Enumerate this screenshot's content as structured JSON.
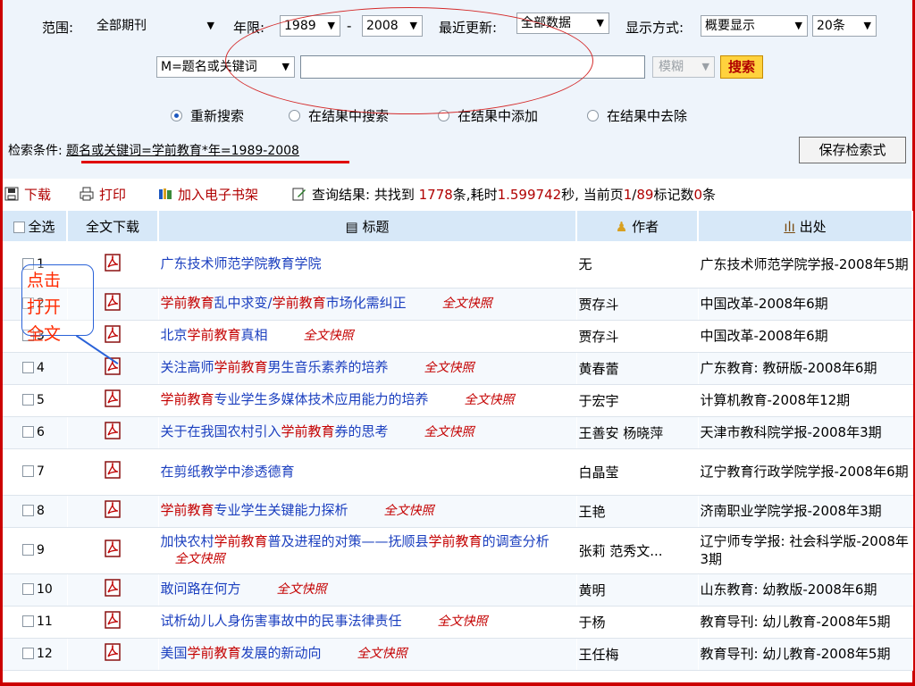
{
  "search": {
    "scope_label": "范围:",
    "scope_value": "全部期刊",
    "year_label": "年限:",
    "year_from": "1989",
    "year_dash": "-",
    "year_to": "2008",
    "update_label": "最近更新:",
    "update_value": "全部数据",
    "display_label": "显示方式:",
    "display_value": "概要显示",
    "count_value": "20条",
    "field_value": "M=题名或关键词",
    "keyword_value": "",
    "match_value": "模糊",
    "search_button": "搜索",
    "radios": [
      {
        "label": "重新搜索",
        "checked": true
      },
      {
        "label": "在结果中搜索",
        "checked": false
      },
      {
        "label": "在结果中添加",
        "checked": false
      },
      {
        "label": "在结果中去除",
        "checked": false
      }
    ],
    "condition_label": "检索条件:",
    "condition_value": "题名或关键词=学前教育*年=1989-2008",
    "save_button": "保存检索式"
  },
  "toolbar": {
    "download": "下载",
    "print": "打印",
    "add_shelf": "加入电子书架",
    "result_prefix": "查询结果: 共找到",
    "total": "1778",
    "items_unit": "条,耗时",
    "elapsed": "1.599742",
    "seconds_unit": "秒,",
    "page_prefix": "当前页",
    "page_current": "1",
    "page_sep": "/",
    "page_total": "89",
    "marked_prefix": "标记数",
    "marked": "0",
    "marked_suffix": "条"
  },
  "table": {
    "headers": {
      "select_all": "全选",
      "fulltext": "全文下载",
      "title": "标题",
      "author": "作者",
      "source": "出处"
    },
    "fulltext_tag": "全文快照",
    "rows": [
      {
        "num": "1",
        "title": [
          {
            "t": "广东技术师范学院教育学院"
          }
        ],
        "snapshot": false,
        "author": "无",
        "source": "广东技术师范学院学报-2008年5期"
      },
      {
        "num": "2",
        "title": [
          {
            "t": "学前教育",
            "h": true
          },
          {
            "t": "乱中求变/"
          },
          {
            "t": "学前教育",
            "h": true
          },
          {
            "t": "市场化需纠正"
          }
        ],
        "snapshot": true,
        "author": "贾存斗",
        "source": "中国改革-2008年6期"
      },
      {
        "num": "3",
        "title": [
          {
            "t": "北京"
          },
          {
            "t": "学前教育",
            "h": true
          },
          {
            "t": "真相"
          }
        ],
        "snapshot": true,
        "author": "贾存斗",
        "source": "中国改革-2008年6期"
      },
      {
        "num": "4",
        "title": [
          {
            "t": "关注高师"
          },
          {
            "t": "学前教育",
            "h": true
          },
          {
            "t": "男生音乐素养的培养"
          }
        ],
        "snapshot": true,
        "author": "黄春蕾",
        "source": "广东教育: 教研版-2008年6期"
      },
      {
        "num": "5",
        "title": [
          {
            "t": "学前教育",
            "h": true
          },
          {
            "t": "专业学生多媒体技术应用能力的培养"
          }
        ],
        "snapshot": true,
        "author": "于宏宇",
        "source": "计算机教育-2008年12期"
      },
      {
        "num": "6",
        "title": [
          {
            "t": "关于在我国农村引入"
          },
          {
            "t": "学前教育",
            "h": true
          },
          {
            "t": "券的思考"
          }
        ],
        "snapshot": true,
        "author": "王善安 杨晓萍",
        "source": "天津市教科院学报-2008年3期"
      },
      {
        "num": "7",
        "title": [
          {
            "t": "在剪纸教学中渗透德育"
          }
        ],
        "snapshot": false,
        "author": "白晶莹",
        "source": "辽宁教育行政学院学报-2008年6期"
      },
      {
        "num": "8",
        "title": [
          {
            "t": "学前教育",
            "h": true
          },
          {
            "t": "专业学生关键能力探析"
          }
        ],
        "snapshot": true,
        "author": "王艳",
        "source": "济南职业学院学报-2008年3期"
      },
      {
        "num": "9",
        "title": [
          {
            "t": "加快农村"
          },
          {
            "t": "学前教育",
            "h": true
          },
          {
            "t": "普及进程的对策——抚顺县"
          },
          {
            "t": "学前教育",
            "h": true
          },
          {
            "t": "的调查分析"
          }
        ],
        "snapshot": true,
        "author": "张莉 范秀文...",
        "source": "辽宁师专学报: 社会科学版-2008年3期"
      },
      {
        "num": "10",
        "title": [
          {
            "t": "敢问路在何方"
          }
        ],
        "snapshot": true,
        "author": "黄明",
        "source": "山东教育: 幼教版-2008年6期"
      },
      {
        "num": "11",
        "title": [
          {
            "t": "试析幼儿人身伤害事故中的民事法律责任"
          }
        ],
        "snapshot": true,
        "author": "于杨",
        "source": "教育导刊: 幼儿教育-2008年5期"
      },
      {
        "num": "12",
        "title": [
          {
            "t": "美国"
          },
          {
            "t": "学前教育",
            "h": true
          },
          {
            "t": "发展的新动向"
          }
        ],
        "snapshot": true,
        "author": "王任梅",
        "source": "教育导刊: 幼儿教育-2008年5期"
      }
    ]
  },
  "annotation": {
    "callout_lines": [
      "点击",
      "打开",
      "全文"
    ]
  },
  "colors": {
    "accent_red": "#c40000",
    "link_blue": "#1b3fbf",
    "header_bg": "#d7e8f8",
    "panel_bg": "#eef4fb"
  }
}
